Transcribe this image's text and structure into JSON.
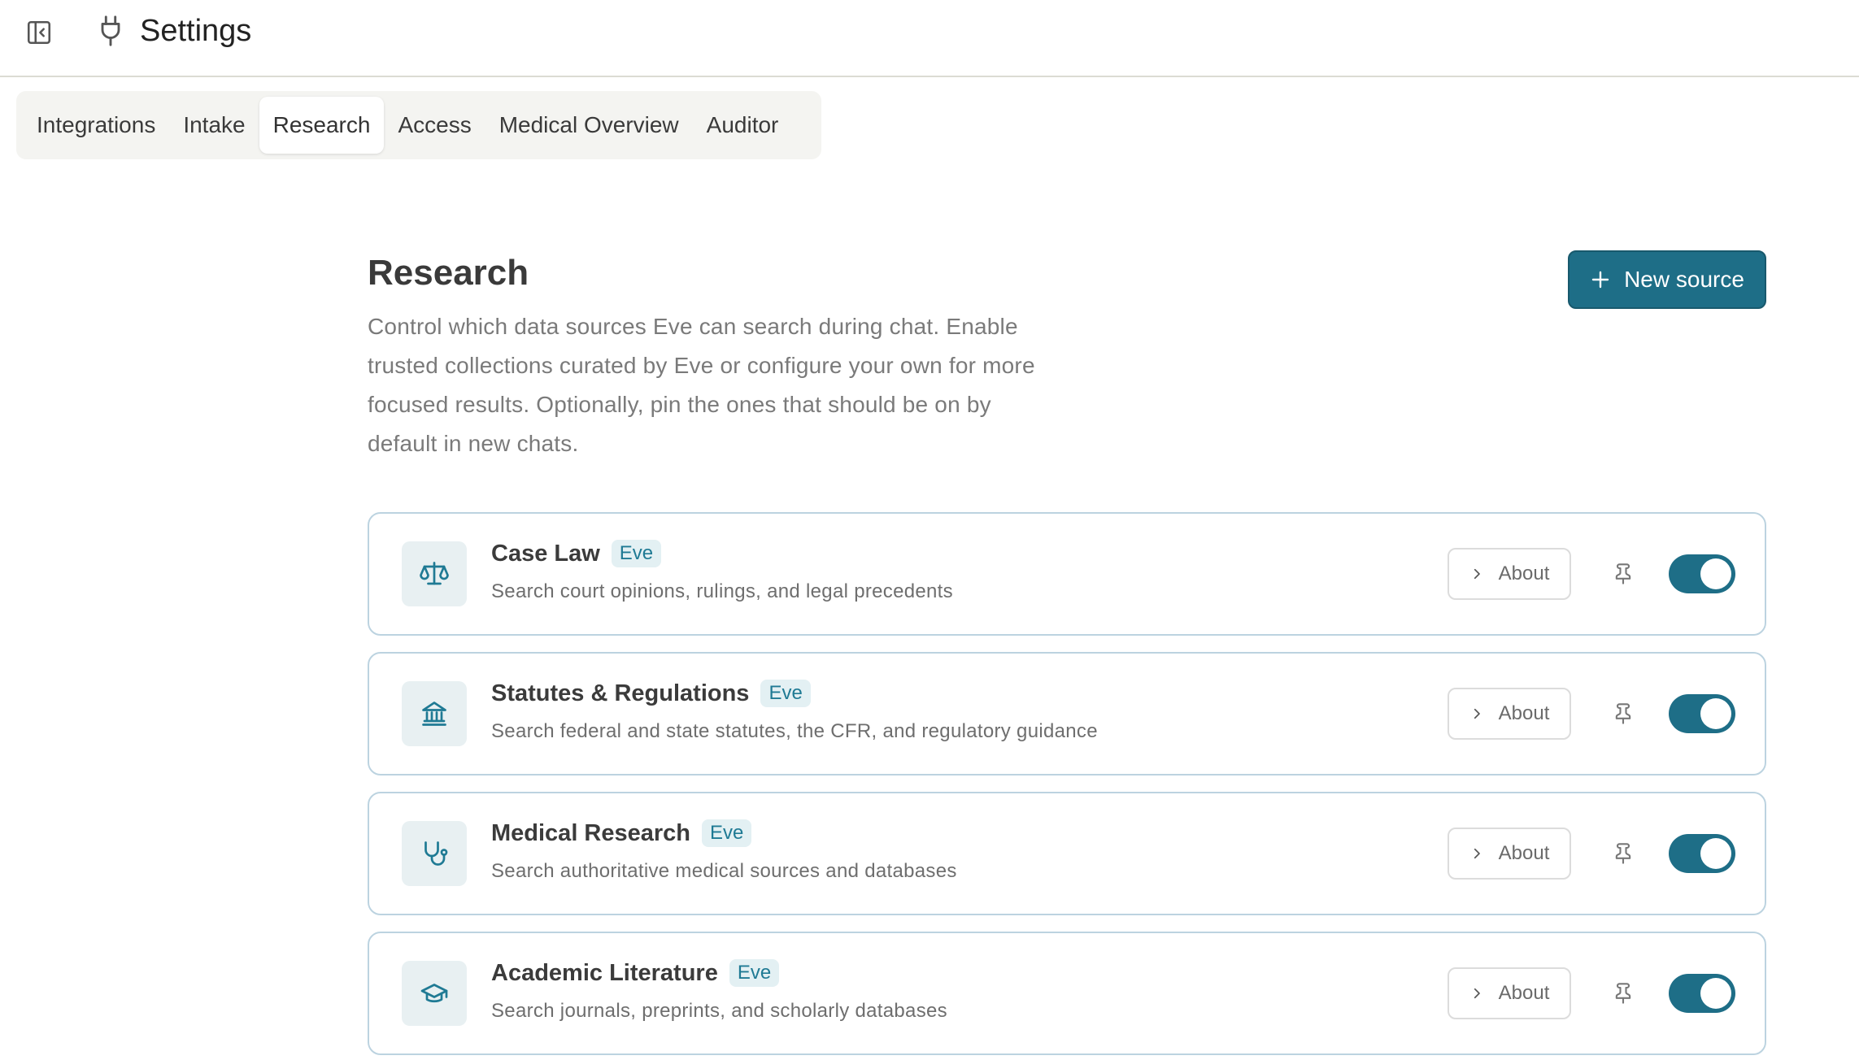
{
  "header": {
    "title": "Settings",
    "sidebar_toggle_icon": "panel-collapse-icon",
    "settings_icon": "plug-icon"
  },
  "tabs": [
    {
      "label": "Integrations",
      "active": false
    },
    {
      "label": "Intake",
      "active": false
    },
    {
      "label": "Research",
      "active": true
    },
    {
      "label": "Access",
      "active": false
    },
    {
      "label": "Medical Overview",
      "active": false
    },
    {
      "label": "Auditor",
      "active": false
    }
  ],
  "main": {
    "title": "Research",
    "description": "Control which data sources Eve can search during chat. Enable trusted collections curated by Eve or configure your own for more focused results. Optionally, pin the ones that should be on by default in new chats.",
    "new_source_label": "New source"
  },
  "sources": [
    {
      "name": "Case Law",
      "badge": "Eve",
      "description": "Search court opinions, rulings, and legal precedents",
      "about_label": "About",
      "icon": "scales-icon",
      "enabled": true,
      "pinned": false
    },
    {
      "name": "Statutes & Regulations",
      "badge": "Eve",
      "description": "Search federal and state statutes, the CFR, and regulatory guidance",
      "about_label": "About",
      "icon": "building-columns-icon",
      "enabled": true,
      "pinned": false
    },
    {
      "name": "Medical Research",
      "badge": "Eve",
      "description": "Search authoritative medical sources and databases",
      "about_label": "About",
      "icon": "stethoscope-icon",
      "enabled": true,
      "pinned": false
    },
    {
      "name": "Academic Literature",
      "badge": "Eve",
      "description": "Search journals, preprints, and scholarly databases",
      "about_label": "About",
      "icon": "graduation-cap-icon",
      "enabled": true,
      "pinned": false
    }
  ],
  "colors": {
    "accent": "#1e6e87",
    "badge_text": "#1f7a94",
    "card_border": "#bcd3e0"
  }
}
